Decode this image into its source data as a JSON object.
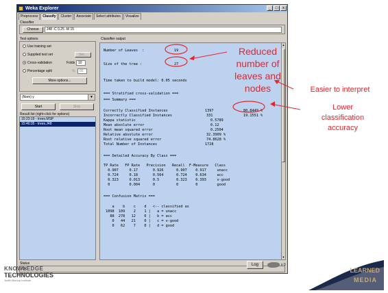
{
  "window": {
    "title": "Weka Explorer",
    "controls": [
      "_",
      "□",
      "x"
    ]
  },
  "tabs": [
    "Preprocess",
    "Classify",
    "Cluster",
    "Associate",
    "Select attributes",
    "Visualize"
  ],
  "classifier": {
    "group_label": "Classifier",
    "choose_label": "Choose",
    "config": "J48 -C 0.25 -M 15"
  },
  "test_options": {
    "label": "Test options",
    "use_training": "Use training set",
    "supplied": "Supplied test set",
    "set_label": "Set...",
    "cv": "Cross-validation",
    "folds_label": "Folds",
    "folds_value": "10",
    "pct": "Percentage split",
    "pct_sym": "%",
    "pct_value": "66",
    "more": "More options..."
  },
  "class_select": "(Nom) y",
  "start_label": "Start",
  "stop_label": "Stop",
  "result_list": {
    "label": "Result list (right-click for options)",
    "items": [
      "15:23:19 - trees.MSP",
      "15:40:35 - trees.J48"
    ]
  },
  "output": {
    "label": "Classifier output",
    "leaves_label": "Number of Leaves  :",
    "leaves_value": "19",
    "size_label": "Size of the tree :",
    "size_value": "27",
    "time_line": "Time taken to build model: 0.05 seconds",
    "strat_header": "=== Stratified cross-validation ===",
    "summary_header": "=== Summary ===",
    "summary": [
      {
        "label": "Correctly Classified Instances",
        "v1": "1397",
        "v2": "80.8449 %"
      },
      {
        "label": "Incorrectly Classified Instances",
        "v1": "331",
        "v2": "19.1551 %"
      },
      {
        "label": "Kappa statistic",
        "v1": "0.5789",
        "v2": ""
      },
      {
        "label": "Mean absolute error",
        "v1": "0.12",
        "v2": ""
      },
      {
        "label": "Root mean squared error",
        "v1": "0.2504",
        "v2": ""
      },
      {
        "label": "Relative absolute error",
        "v1": "32.3909 %",
        "v2": ""
      },
      {
        "label": "Root relative squared error",
        "v1": "74.8628 %",
        "v2": ""
      },
      {
        "label": "Total Number of Instances",
        "v1": "1728",
        "v2": ""
      }
    ],
    "detail_header": "=== Detailed Accuracy By Class ===",
    "detail_cols": "TP Rate   FP Rate   Precision   Recall  F-Measure   Class",
    "detail_rows": [
      "  0.907     0.17       0.926      0.907    0.917     unacc",
      "  0.724     0.18       0.564      0.724    0.634     acc",
      "  0.323     0.013      0.5        0.323    0.393     v-good",
      "  0         0.004      0          0        0         good"
    ],
    "confusion_header": "=== Confusion Matrix ===",
    "confusion_cols": "    a    b    c    d   <-- classified as",
    "confusion_rows": [
      " 1098  109    2    1 |   a = unacc",
      "   88  278   12    6 |   b = acc",
      "    0   44   21    0 |   c = v-good",
      "    0   62    7    0 |   d = good"
    ]
  },
  "status": {
    "label": "Status",
    "value": "OK",
    "log_label": "Log",
    "x_label": "x 0"
  },
  "annotations": {
    "reduced_line1": "Reduced",
    "reduced_line2": "number of",
    "reduced_line3": "leaves and",
    "reduced_line4": "nodes",
    "easier": "Easier to interpret",
    "lower_line1": "Lower",
    "lower_line2": "classification",
    "lower_line3": "accuracy"
  },
  "logo": {
    "line1": "KNOWLEDGE",
    "line2": "TECHNOLOGIES",
    "small": "Judith Bishop Institute"
  },
  "media_text": {
    "line1": "LEARNED",
    "line2": "MEDIA"
  },
  "colors": {
    "annotation": "#e8232a",
    "output_bg": "#bcd2ee",
    "titlebar": "#0a246a"
  }
}
